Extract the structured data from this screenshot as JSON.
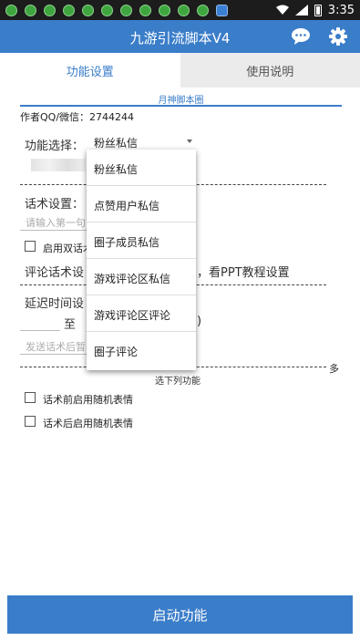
{
  "status_bar": {
    "time": "3:35",
    "notification_icons": [
      "notif-icon",
      "notif-icon",
      "notif-icon",
      "notif-icon",
      "notif-icon",
      "notif-icon",
      "notif-icon",
      "notif-icon",
      "notif-icon",
      "notif-icon",
      "notif-icon",
      "app-icon"
    ]
  },
  "app_bar": {
    "title": "九游引流脚本V4",
    "chat_icon": "chat-bubble-icon",
    "settings_icon": "gear-icon",
    "color": "#3a7dc9"
  },
  "tabs": [
    {
      "label": "功能设置",
      "active": true
    },
    {
      "label": "使用说明",
      "active": false
    }
  ],
  "banner": "月神脚本圈",
  "author": "作者QQ/微信：2744244",
  "function_select": {
    "label": "功能选择：",
    "selected": "粉丝私信",
    "options": [
      "粉丝私信",
      "点赞用户私信",
      "圈子成员私信",
      "游戏评论区私信",
      "游戏评论区评论",
      "圈子评论"
    ]
  },
  "script_setting": {
    "label": "话术设置：",
    "placeholder": "请输入第一句"
  },
  "dual_script": {
    "label": "启用双话术",
    "checked": false
  },
  "comment_script": {
    "label": "评论话术设",
    "hint": "，看PPT教程设置"
  },
  "delay": {
    "label": "延迟时间设",
    "to": "至",
    "paren": ")",
    "pause_placeholder": "发送话术后暂"
  },
  "section_note": "选下列功能",
  "more": "多",
  "options": [
    {
      "label": "话术前启用随机表情",
      "checked": false
    },
    {
      "label": "话术后启用随机表情",
      "checked": false
    }
  ],
  "start_button": "启动功能"
}
